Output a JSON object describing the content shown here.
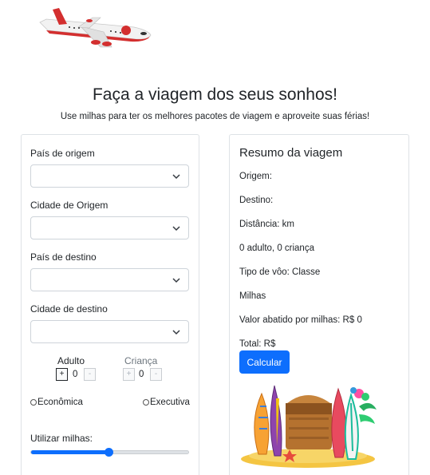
{
  "hero": {
    "title": "Faça a viagem dos seus sonhos!",
    "subtitle": "Use milhas para ter os melhores pacotes de viagem e aproveite suas férias!"
  },
  "form": {
    "origin_country_label": "País de origem",
    "origin_country_value": "",
    "origin_city_label": "Cidade de Origem",
    "origin_city_value": "",
    "dest_country_label": "País de destino",
    "dest_country_value": "",
    "dest_city_label": "Cidade de destino",
    "dest_city_value": "",
    "adult": {
      "label": "Adulto",
      "plus": "+",
      "minus": "-",
      "value": "0"
    },
    "child": {
      "label": "Criança",
      "plus": "+",
      "minus": "-",
      "value": "0"
    },
    "class_options": [
      "Econômica",
      "Executiva"
    ],
    "miles_label": "Utilizar milhas:",
    "miles_slider_fraction": 0.49
  },
  "summary": {
    "title": "Resumo da viagem",
    "origin": "Origem:",
    "destination": "Destino:",
    "distance": "Distância: km",
    "passengers": "0 adulto, 0 criança",
    "flight_type": "Tipo de vôo: Classe",
    "miles": "Milhas",
    "discount": "Valor abatido por milhas: R$ 0",
    "total": "Total: R$",
    "calculate_label": "Calcular"
  },
  "colors": {
    "accent": "#0d6efd",
    "border": "#dee2e6",
    "text": "#212529"
  },
  "icons": {
    "logo": "airplane-logo-icon",
    "select_caret": "chevron-down-icon",
    "illustration": "beach-surfboards-icon"
  }
}
